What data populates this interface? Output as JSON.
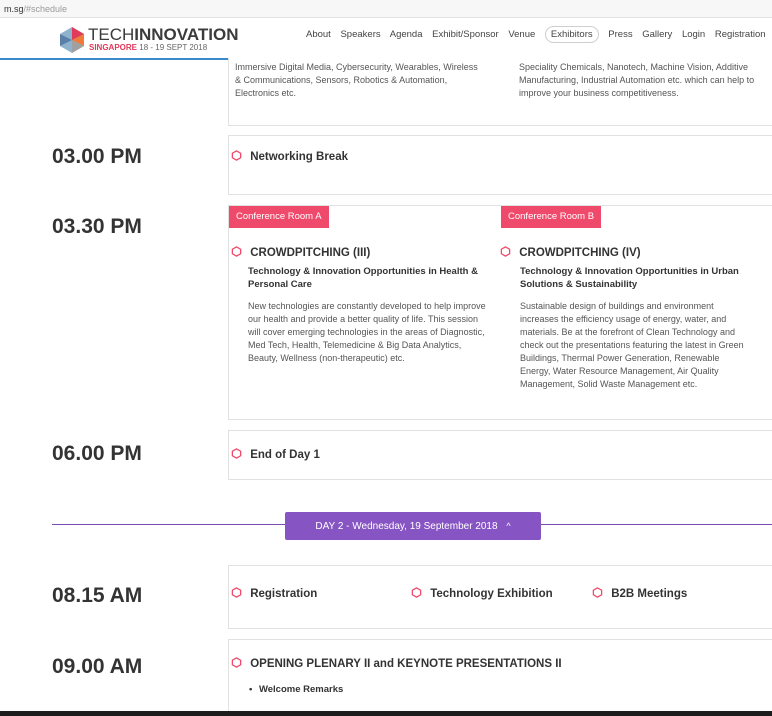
{
  "browser": {
    "url_domain": "m.sg",
    "url_path": "/#schedule"
  },
  "header": {
    "logo_light": "TECH",
    "logo_bold": "INNOVATION",
    "logo_city": "SINGAPORE",
    "logo_dates": "18 - 19 SEPT 2018",
    "nav": [
      "About",
      "Speakers",
      "Agenda",
      "Exhibit/Sponsor",
      "Venue",
      "Exhibitors",
      "Press",
      "Gallery",
      "Login",
      "Registration"
    ],
    "active_nav": "Exhibitors"
  },
  "top_partial": {
    "left_text": "Immersive Digital Media, Cybersecurity, Wearables, Wireless & Communications, Sensors, Robotics & Automation, Electronics etc.",
    "right_text": "Speciality Chemicals, Nanotech, Machine Vision, Additive Manufacturing, Industrial Automation etc. which can help to improve your business competitiveness."
  },
  "schedule": {
    "slot_1500": {
      "time": "03.00 PM",
      "title": "Networking Break"
    },
    "slot_1530": {
      "time": "03.30 PM",
      "room_a": {
        "room": "Conference Room A",
        "title": "CROWDPITCHING (III)",
        "subtitle": "Technology & Innovation Opportunities in Health & Personal Care",
        "desc": "New technologies are constantly developed to help improve our health and provide a better quality of life. This session will cover emerging technologies in the areas of Diagnostic, Med Tech, Health, Telemedicine & Big Data Analytics, Beauty, Wellness (non-therapeutic) etc."
      },
      "room_b": {
        "room": "Conference Room B",
        "title": "CROWDPITCHING (IV)",
        "subtitle": "Technology & Innovation Opportunities in Urban Solutions & Sustainability",
        "desc": "Sustainable design of buildings and environment increases the efficiency usage of energy, water, and materials. Be at the forefront of Clean Technology and check out the presentations featuring the latest in Green Buildings, Thermal Power Generation, Renewable Energy, Water Resource Management, Air Quality Management, Solid Waste Management etc."
      }
    },
    "slot_1800": {
      "time": "06.00 PM",
      "title": "End of Day 1"
    },
    "day2_label": "DAY 2 - Wednesday, 19 September 2018",
    "day2_chevron": "^",
    "slot_0815": {
      "time": "08.15 AM",
      "items": [
        "Registration",
        "Technology Exhibition",
        "B2B Meetings"
      ]
    },
    "slot_0900": {
      "time": "09.00 AM",
      "title": "OPENING PLENARY II and KEYNOTE PRESENTATIONS II",
      "bullet": "Welcome Remarks"
    }
  },
  "colors": {
    "accent_pink": "#ef4a6b",
    "day_purple": "#8755c3",
    "header_blue": "#3a8ac9"
  },
  "icons": {
    "session_marker": "hexagon-outline-icon",
    "logo_mark": "hexagon-logo-icon"
  }
}
